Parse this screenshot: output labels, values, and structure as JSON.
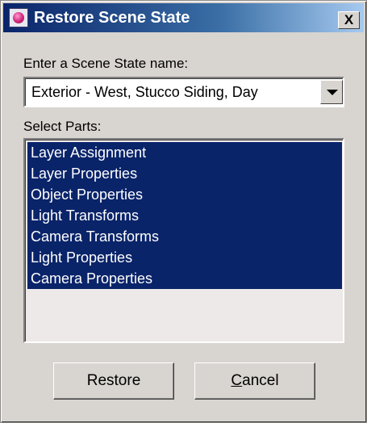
{
  "window": {
    "title": "Restore Scene State",
    "close_label": "X"
  },
  "scene_state": {
    "label": "Enter a Scene State name:",
    "selected_value": "Exterior - West, Stucco Siding,  Day"
  },
  "parts": {
    "label": "Select Parts:",
    "items": [
      {
        "label": "Layer Assignment",
        "selected": true
      },
      {
        "label": "Layer Properties",
        "selected": true
      },
      {
        "label": "Object Properties",
        "selected": true
      },
      {
        "label": "Light Transforms",
        "selected": true
      },
      {
        "label": "Camera Transforms",
        "selected": true
      },
      {
        "label": "Light Properties",
        "selected": true
      },
      {
        "label": "Camera Properties",
        "selected": true
      }
    ]
  },
  "buttons": {
    "restore_label": "Restore",
    "cancel_mnemonic": "C",
    "cancel_rest": "ancel"
  },
  "colors": {
    "selection": "#0a246a",
    "titlebar_start": "#0a246a",
    "titlebar_end": "#a6caf0",
    "dialog_bg": "#d8d4d0"
  }
}
